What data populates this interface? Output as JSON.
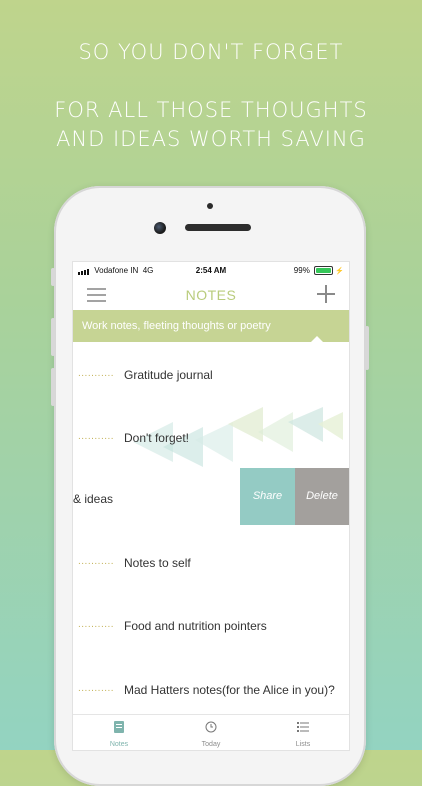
{
  "promo": {
    "line1": "SO YOU DON'T FORGET",
    "line2": "FOR ALL THOSE THOUGHTS AND IDEAS WORTH SAVING"
  },
  "status_bar": {
    "carrier": "Vodafone IN",
    "network": "4G",
    "time": "2:54 AM",
    "battery": "99%"
  },
  "navbar": {
    "title": "NOTES",
    "menu_icon": "hamburger-icon",
    "add_icon": "plus-icon"
  },
  "banner": {
    "text": "Work notes, fleeting thoughts or poetry"
  },
  "notes": [
    {
      "dots": "...........",
      "title": "Gratitude journal"
    },
    {
      "dots": "...........",
      "title": "Don't forget!"
    },
    {
      "dots": "...........",
      "title": "Notes to self"
    },
    {
      "dots": "...........",
      "title": "Food and nutrition pointers"
    },
    {
      "dots": "...........",
      "title": "Mad Hatters notes(for the Alice in you)?"
    }
  ],
  "swiped_note": {
    "title_fragment": "& ideas",
    "share_label": "Share",
    "delete_label": "Delete"
  },
  "tabs": [
    {
      "label": "Notes",
      "icon": "note-icon",
      "active": true
    },
    {
      "label": "Today",
      "icon": "clock-icon",
      "active": false
    },
    {
      "label": "Lists",
      "icon": "list-icon",
      "active": false
    }
  ],
  "colors": {
    "accent_green": "#c6d494",
    "share_teal": "#94cbc4",
    "delete_gray": "#a3a09d",
    "title_green": "#b9cc7c"
  }
}
